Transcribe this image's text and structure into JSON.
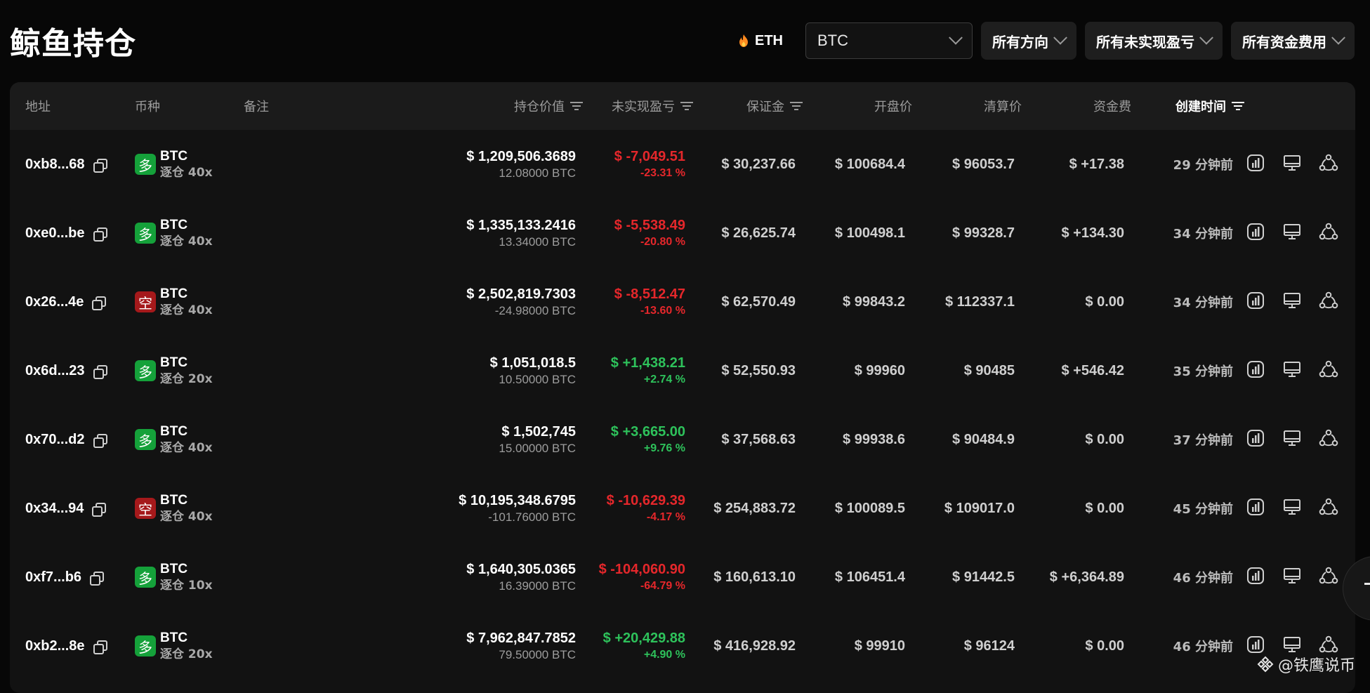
{
  "page": {
    "title": "鲸鱼持仓"
  },
  "filters": {
    "eth_label": "ETH",
    "coin_value": "BTC",
    "direction": "所有方向",
    "pnl": "所有未实现盈亏",
    "funding": "所有资金费用"
  },
  "columns": {
    "address": "地址",
    "coin": "币种",
    "note": "备注",
    "position_value": "持仓价值",
    "unrealized_pnl": "未实现盈亏",
    "margin": "保证金",
    "open_price": "开盘价",
    "liq_price": "清算价",
    "funding_fee": "资金费",
    "created": "创建时间"
  },
  "rows": [
    {
      "address": "0xb8...68",
      "side": "多",
      "side_type": "long",
      "coin": "BTC",
      "leverage": "逐仓 40x",
      "value": "$ 1,209,506.3689",
      "size": "12.08000 BTC",
      "pnl": "$ -7,049.51",
      "pnl_pct": "-23.31 %",
      "pnl_type": "neg",
      "margin": "$ 30,237.66",
      "open": "$ 100684.4",
      "liq": "$ 96053.7",
      "funding": "$ +17.38",
      "funding_type": "pos",
      "time": "29 分钟前"
    },
    {
      "address": "0xe0...be",
      "side": "多",
      "side_type": "long",
      "coin": "BTC",
      "leverage": "逐仓 40x",
      "value": "$ 1,335,133.2416",
      "size": "13.34000 BTC",
      "pnl": "$ -5,538.49",
      "pnl_pct": "-20.80 %",
      "pnl_type": "neg",
      "margin": "$ 26,625.74",
      "open": "$ 100498.1",
      "liq": "$ 99328.7",
      "funding": "$ +134.30",
      "funding_type": "pos",
      "time": "34 分钟前"
    },
    {
      "address": "0x26...4e",
      "side": "空",
      "side_type": "short",
      "coin": "BTC",
      "leverage": "逐仓 40x",
      "value": "$ 2,502,819.7303",
      "size": "-24.98000 BTC",
      "pnl": "$ -8,512.47",
      "pnl_pct": "-13.60 %",
      "pnl_type": "neg",
      "margin": "$ 62,570.49",
      "open": "$ 99843.2",
      "liq": "$ 112337.1",
      "funding": "$ 0.00",
      "funding_type": "grey",
      "time": "34 分钟前"
    },
    {
      "address": "0x6d...23",
      "side": "多",
      "side_type": "long",
      "coin": "BTC",
      "leverage": "逐仓 20x",
      "value": "$ 1,051,018.5",
      "size": "10.50000 BTC",
      "pnl": "$ +1,438.21",
      "pnl_pct": "+2.74 %",
      "pnl_type": "pos",
      "margin": "$ 52,550.93",
      "open": "$ 99960",
      "liq": "$ 90485",
      "funding": "$ +546.42",
      "funding_type": "pos",
      "time": "35 分钟前"
    },
    {
      "address": "0x70...d2",
      "side": "多",
      "side_type": "long",
      "coin": "BTC",
      "leverage": "逐仓 40x",
      "value": "$ 1,502,745",
      "size": "15.00000 BTC",
      "pnl": "$ +3,665.00",
      "pnl_pct": "+9.76 %",
      "pnl_type": "pos",
      "margin": "$ 37,568.63",
      "open": "$ 99938.6",
      "liq": "$ 90484.9",
      "funding": "$ 0.00",
      "funding_type": "grey",
      "time": "37 分钟前"
    },
    {
      "address": "0x34...94",
      "side": "空",
      "side_type": "short",
      "coin": "BTC",
      "leverage": "逐仓 40x",
      "value": "$ 10,195,348.6795",
      "size": "-101.76000 BTC",
      "pnl": "$ -10,629.39",
      "pnl_pct": "-4.17 %",
      "pnl_type": "neg",
      "margin": "$ 254,883.72",
      "open": "$ 100089.5",
      "liq": "$ 109017.0",
      "funding": "$ 0.00",
      "funding_type": "grey",
      "time": "45 分钟前"
    },
    {
      "address": "0xf7...b6",
      "side": "多",
      "side_type": "long",
      "coin": "BTC",
      "leverage": "逐仓 10x",
      "value": "$ 1,640,305.0365",
      "size": "16.39000 BTC",
      "pnl": "$ -104,060.90",
      "pnl_pct": "-64.79 %",
      "pnl_type": "neg",
      "margin": "$ 160,613.10",
      "open": "$ 106451.4",
      "liq": "$ 91442.5",
      "funding": "$ +6,364.89",
      "funding_type": "pos",
      "time": "46 分钟前"
    },
    {
      "address": "0xb2...8e",
      "side": "多",
      "side_type": "long",
      "coin": "BTC",
      "leverage": "逐仓 20x",
      "value": "$ 7,962,847.7852",
      "size": "79.50000 BTC",
      "pnl": "$ +20,429.88",
      "pnl_pct": "+4.90 %",
      "pnl_type": "pos",
      "margin": "$ 416,928.92",
      "open": "$ 99910",
      "liq": "$ 96124",
      "funding": "$ 0.00",
      "funding_type": "grey",
      "time": "46 分钟前"
    }
  ],
  "watermark": "@铁鹰说币",
  "colors": {
    "long": "#15a13a",
    "short": "#a5191b",
    "positive": "#2ec25b",
    "negative": "#e5272b"
  }
}
